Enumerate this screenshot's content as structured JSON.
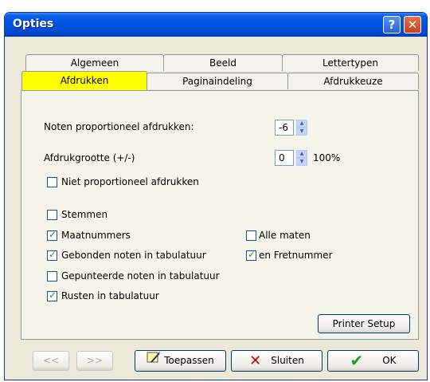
{
  "window": {
    "title": "Opties"
  },
  "titlebar_buttons": {
    "help": "?",
    "close": "✕"
  },
  "tabs": {
    "row1": [
      "Algemeen",
      "Beeld",
      "Lettertypen"
    ],
    "row2": [
      "Afdrukken",
      "Paginaindeling",
      "Afdrukkeuze"
    ],
    "active": "Afdrukken"
  },
  "form": {
    "proportional_label": "Noten proportioneel afdrukken:",
    "proportional_value": "-6",
    "size_label": "Afdrukgrootte (+/-)",
    "size_value": "0",
    "size_percent": "100%",
    "nonproportional": {
      "label": "Niet proportioneel afdrukken",
      "checked": false
    },
    "stemmen": {
      "label": "Stemmen",
      "checked": false
    },
    "maatnummers": {
      "label": "Maatnummers",
      "checked": true
    },
    "alle_maten": {
      "label": "Alle maten",
      "checked": false
    },
    "gebonden": {
      "label": "Gebonden noten in tabulatuur",
      "checked": true
    },
    "fretnummer": {
      "label": "en Fretnummer",
      "checked": true
    },
    "gepunteerde": {
      "label": "Gepunteerde noten in tabulatuur",
      "checked": false
    },
    "rusten": {
      "label": "Rusten in tabulatuur",
      "checked": true
    },
    "printer_setup": "Printer Setup"
  },
  "footer": {
    "prev": "<<",
    "next": ">>",
    "apply": "Toepassen",
    "close": "Sluiten",
    "ok": "OK"
  },
  "colors": {
    "active_tab": "#ffff00",
    "check": "#21a121",
    "close_x": "#cc0000"
  }
}
